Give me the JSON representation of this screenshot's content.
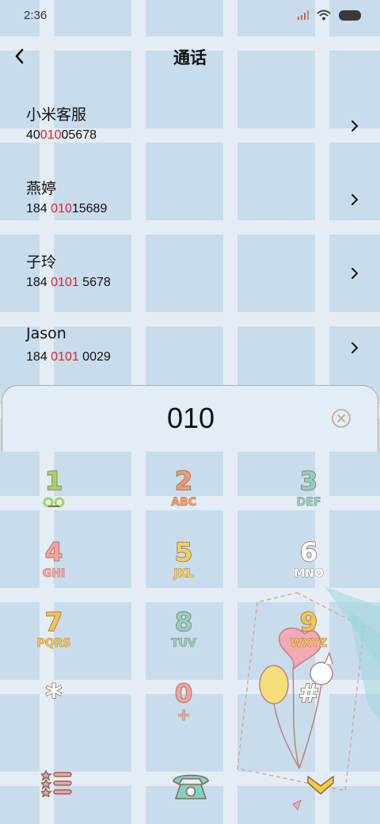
{
  "status_bar": {
    "time": "2:36",
    "icons": [
      "signal-icon",
      "wifi-icon",
      "battery-icon"
    ]
  },
  "header": {
    "title": "通话"
  },
  "contacts": [
    {
      "name": "小米客服",
      "number_parts": [
        "40",
        "010",
        "05678"
      ]
    },
    {
      "name": "燕婷",
      "number_parts": [
        "184 ",
        "010",
        "15689"
      ]
    },
    {
      "name": "子玲",
      "number_parts": [
        "184 ",
        "0101",
        " 5678"
      ]
    },
    {
      "name": "Jason",
      "number_parts": [
        "184 ",
        "0101",
        " 0029"
      ]
    }
  ],
  "dialer": {
    "input_value": "010",
    "keys": [
      {
        "digit": "1",
        "letters": "",
        "color": "#a5d36b"
      },
      {
        "digit": "2",
        "letters": "ABC",
        "color": "#f39a64"
      },
      {
        "digit": "3",
        "letters": "DEF",
        "color": "#8fd0c4"
      },
      {
        "digit": "4",
        "letters": "GHI",
        "color": "#f6a0a0"
      },
      {
        "digit": "5",
        "letters": "JKL",
        "color": "#f6cf5c"
      },
      {
        "digit": "6",
        "letters": "MNO",
        "color": "#ffffff"
      },
      {
        "digit": "7",
        "letters": "PQRS",
        "color": "#f9c24a"
      },
      {
        "digit": "8",
        "letters": "TUV",
        "color": "#8fd0c4"
      },
      {
        "digit": "9",
        "letters": "WXYZ",
        "color": "#f9c24a"
      },
      {
        "digit": "*",
        "letters": "",
        "color": "#ffffff"
      },
      {
        "digit": "0",
        "letters": "+",
        "color": "#f6a0a0"
      },
      {
        "digit": "#",
        "letters": "",
        "color": "#ffffff"
      }
    ]
  },
  "colors": {
    "highlight": "#e52222",
    "panel_border": "#c9a489",
    "icon_outline": "#8a6a58"
  }
}
